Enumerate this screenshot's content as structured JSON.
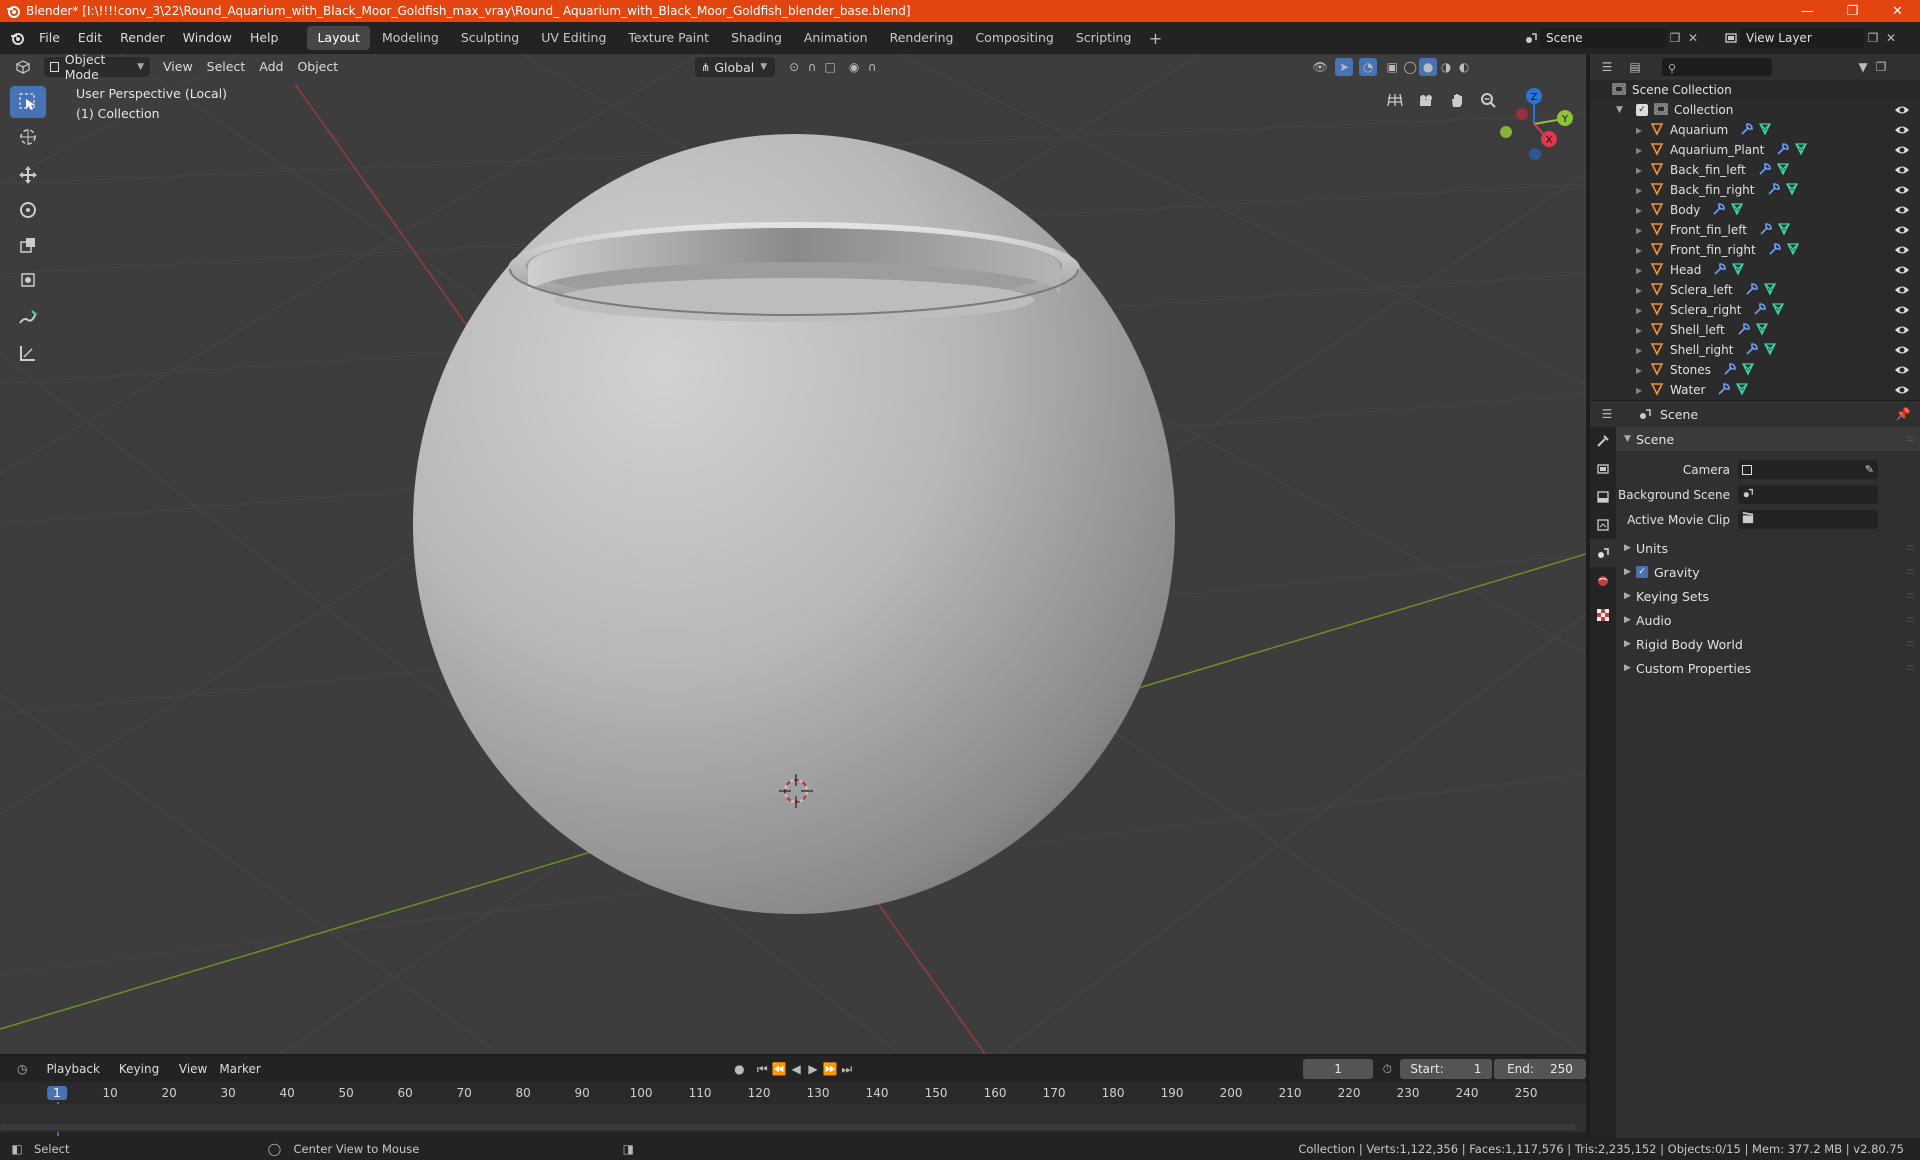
{
  "window": {
    "title": "Blender* [I:\\!!!!conv_3\\22\\Round_Aquarium_with_Black_Moor_Goldfish_max_vray\\Round_ Aquarium_with_Black_Moor_Goldfish_blender_base.blend]",
    "controls": [
      "minimize",
      "restore",
      "close"
    ]
  },
  "menu": [
    "File",
    "Edit",
    "Render",
    "Window",
    "Help"
  ],
  "workspaces": {
    "active": "Layout",
    "tabs": [
      "Layout",
      "Modeling",
      "Sculpting",
      "UV Editing",
      "Texture Paint",
      "Shading",
      "Animation",
      "Rendering",
      "Compositing",
      "Scripting"
    ]
  },
  "scene_selector": {
    "value": "Scene"
  },
  "view_layer_selector": {
    "value": "View Layer"
  },
  "viewport": {
    "mode": "Object Mode",
    "menus": [
      "View",
      "Select",
      "Add",
      "Object"
    ],
    "transform_orientation": "Global",
    "info_line1": "User Perspective (Local)",
    "info_line2": "(1) Collection",
    "gizmo_axes": {
      "x": "X",
      "y": "Y",
      "z": "Z"
    }
  },
  "outliner": {
    "root": "Scene Collection",
    "collection": "Collection",
    "objects": [
      "Aquarium",
      "Aquarium_Plant",
      "Back_fin_left",
      "Back_fin_right",
      "Body",
      "Front_fin_left",
      "Front_fin_right",
      "Head",
      "Sclera_left",
      "Sclera_right",
      "Shell_left",
      "Shell_right",
      "Stones",
      "Water"
    ]
  },
  "properties": {
    "context": "Scene",
    "panel_title": "Scene",
    "fields": {
      "camera_label": "Camera",
      "background_scene_label": "Background Scene",
      "active_movie_clip_label": "Active Movie Clip"
    },
    "subpanels": [
      "Units",
      "Gravity",
      "Keying Sets",
      "Audio",
      "Rigid Body World",
      "Custom Properties"
    ],
    "gravity_enabled": true
  },
  "timeline": {
    "menus": [
      "Playback",
      "Keying",
      "View",
      "Marker"
    ],
    "current_frame": "1",
    "start_label": "Start:",
    "start": "1",
    "end_label": "End:",
    "end": "250",
    "ruler": [
      "1",
      "10",
      "20",
      "30",
      "40",
      "50",
      "60",
      "70",
      "80",
      "90",
      "100",
      "110",
      "120",
      "130",
      "140",
      "150",
      "160",
      "170",
      "180",
      "190",
      "200",
      "210",
      "220",
      "230",
      "240",
      "250"
    ]
  },
  "statusbar": {
    "left": "Select",
    "middle": "Center View to Mouse",
    "right": "Collection | Verts:1,122,356 | Faces:1,117,576 | Tris:2,235,152 | Objects:0/15 | Mem: 377.2 MB | v2.80.75"
  },
  "colors": {
    "title_bar": "#e2450f",
    "accent": "#4772b3",
    "object_icon": "#f0953a",
    "modifier_icon": "#6aa0f5",
    "mesh_icon": "#3fd4a8"
  }
}
